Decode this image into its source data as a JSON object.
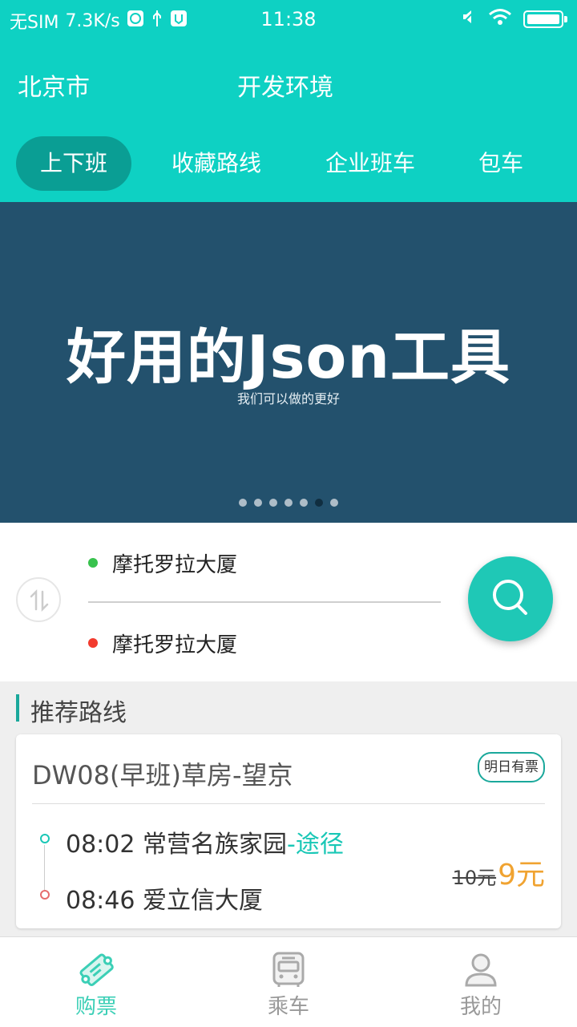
{
  "status_bar": {
    "carrier": "无SIM",
    "speed": "7.3K/s",
    "time": "11:38"
  },
  "header": {
    "city": "北京市",
    "env": "开发环境",
    "accent_color": "#0ed1c3"
  },
  "tabs": [
    {
      "label": "上下班",
      "active": true
    },
    {
      "label": "收藏路线",
      "active": false
    },
    {
      "label": "企业班车",
      "active": false
    },
    {
      "label": "包车",
      "active": false
    }
  ],
  "banner": {
    "title": "好用的Json工具",
    "subtitle": "我们可以做的更好",
    "background": "#23516d",
    "page_count": 7,
    "active_page": 6
  },
  "search": {
    "start": "摩托罗拉大厦",
    "end": "摩托罗拉大厦",
    "start_color": "#38c24d",
    "end_color": "#f23b2e"
  },
  "recommend": {
    "section_title": "推荐路线",
    "route_name": "DW08(早班)草房-望京",
    "badge": "明日有票",
    "start_time": "08:02",
    "start_stop": "常营名族家园",
    "via_text": "-途径",
    "end_time": "08:46",
    "end_stop": "爱立信大厦",
    "old_price": "10元",
    "new_price": "9元"
  },
  "bottom_nav": [
    {
      "label": "购票",
      "icon": "ticket-icon",
      "active": true
    },
    {
      "label": "乘车",
      "icon": "bus-icon",
      "active": false
    },
    {
      "label": "我的",
      "icon": "user-icon",
      "active": false
    }
  ]
}
